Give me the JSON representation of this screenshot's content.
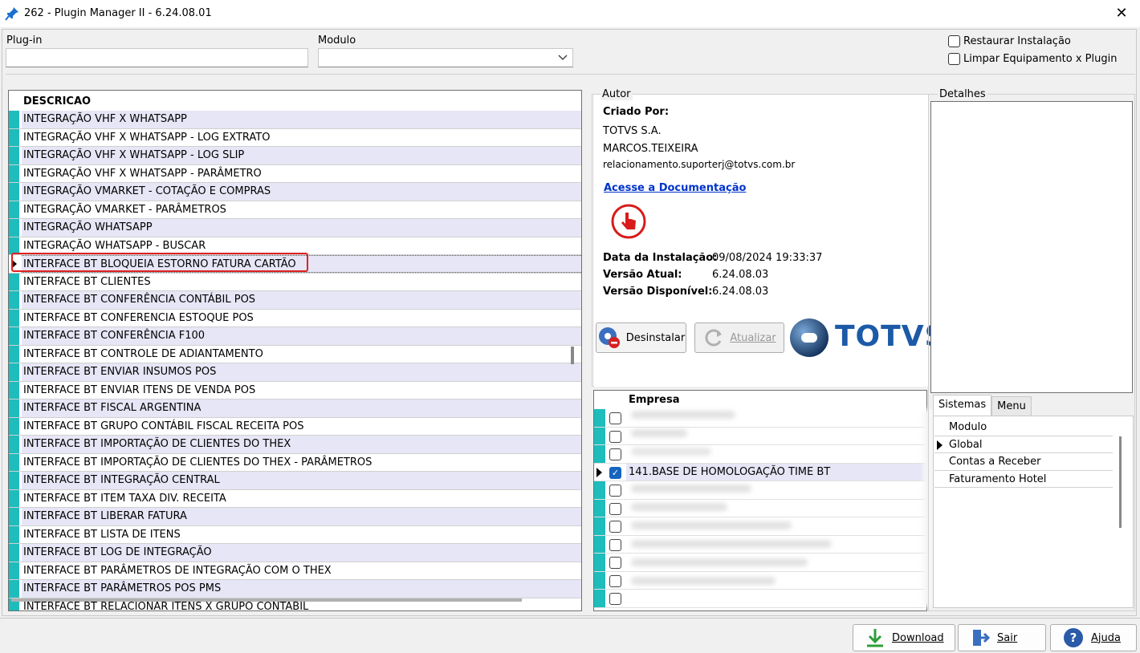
{
  "window": {
    "title": "262 - Plugin Manager II - 6.24.08.01"
  },
  "filters": {
    "plugin_label": "Plug-in",
    "plugin_value": "",
    "modulo_label": "Modulo",
    "modulo_value": "",
    "restaurar_label": "Restaurar Instalação",
    "limpar_label": "Limpar Equipamento x Plugin"
  },
  "plugin_grid": {
    "header": "DESCRICAO",
    "rows": [
      "INTEGRAÇÃO VHF X WHATSAPP",
      "INTEGRAÇÃO VHF X WHATSAPP - LOG EXTRATO",
      "INTEGRAÇÃO VHF X WHATSAPP - LOG SLIP",
      "INTEGRAÇÃO VHF X WHATSAPP - PARÂMETRO",
      "INTEGRAÇÃO VMARKET - COTAÇÃO E COMPRAS",
      "INTEGRAÇÃO VMARKET - PARÂMETROS",
      "INTEGRAÇÃO WHATSAPP",
      "INTEGRAÇÃO WHATSAPP - BUSCAR",
      "INTERFACE BT BLOQUEIA ESTORNO FATURA CARTÃO",
      "INTERFACE BT CLIENTES",
      "INTERFACE BT CONFERÊNCIA CONTÁBIL POS",
      "INTERFACE BT CONFERENCIA ESTOQUE POS",
      "INTERFACE BT CONFERÊNCIA F100",
      "INTERFACE BT CONTROLE DE ADIANTAMENTO",
      "INTERFACE BT ENVIAR INSUMOS POS",
      "INTERFACE BT ENVIAR ITENS DE VENDA POS",
      "INTERFACE BT FISCAL ARGENTINA",
      "INTERFACE BT GRUPO CONTÁBIL FISCAL RECEITA POS",
      "INTERFACE BT IMPORTAÇÃO DE CLIENTES DO THEX",
      "INTERFACE BT IMPORTAÇÃO DE CLIENTES DO THEX - PARÂMETROS",
      "INTERFACE BT INTEGRAÇÃO CENTRAL",
      "INTERFACE BT ITEM TAXA DIV. RECEITA",
      "INTERFACE BT LIBERAR FATURA",
      "INTERFACE BT LISTA DE ITENS",
      "INTERFACE BT LOG DE INTEGRAÇÃO",
      "INTERFACE BT PARÂMETROS DE INTEGRAÇÃO COM O THEX",
      "INTERFACE BT PARÂMETROS POS PMS",
      "INTERFACE BT RELACIONAR ITENS X GRUPO CONTÁBIL"
    ],
    "selected_index": 8
  },
  "autor": {
    "group_label": "Autor",
    "criado_por_label": "Criado Por:",
    "company": "TOTVS S.A.",
    "author": "MARCOS.TEIXEIRA",
    "email": "relacionamento.suporterj@totvs.com.br",
    "doc_link": "Acesse a Documentação",
    "data_instalacao_label": "Data da Instalação:",
    "data_instalacao_value": "09/08/2024 19:33:37",
    "versao_atual_label": "Versão Atual:",
    "versao_atual_value": "6.24.08.03",
    "versao_disponivel_label": "Versão Disponível:",
    "versao_disponivel_value": "6.24.08.03",
    "desinstalar_label": "Desinstalar",
    "atualizar_label": "Atualizar",
    "logo_text": "TOTVS"
  },
  "empresa_grid": {
    "header": "Empresa",
    "rows": [
      {
        "name": "",
        "checked": false
      },
      {
        "name": "",
        "checked": false
      },
      {
        "name": "",
        "checked": false
      },
      {
        "name": "141.BASE DE HOMOLOGAÇÃO TIME BT",
        "checked": true
      },
      {
        "name": "",
        "checked": false
      },
      {
        "name": "",
        "checked": false
      },
      {
        "name": "",
        "checked": false
      },
      {
        "name": "",
        "checked": false
      },
      {
        "name": "",
        "checked": false
      },
      {
        "name": "",
        "checked": false
      },
      {
        "name": "",
        "checked": false
      }
    ],
    "selected_index": 3
  },
  "detalhes": {
    "group_label": "Detalhes",
    "tabs": [
      "Sistemas",
      "Menu"
    ],
    "sistemas": [
      "Modulo",
      "Global",
      "Contas a Receber",
      "Faturamento Hotel"
    ],
    "selected_index": 1
  },
  "footer": {
    "download_label": "Download",
    "sair_label": "Sair",
    "ajuda_label": "Ajuda"
  },
  "colors": {
    "indicator": "#1fbcbc",
    "row_alt": "#e6e6f6",
    "highlight": "#e02020",
    "link": "#0033cc",
    "brand": "#1c5aa8"
  }
}
